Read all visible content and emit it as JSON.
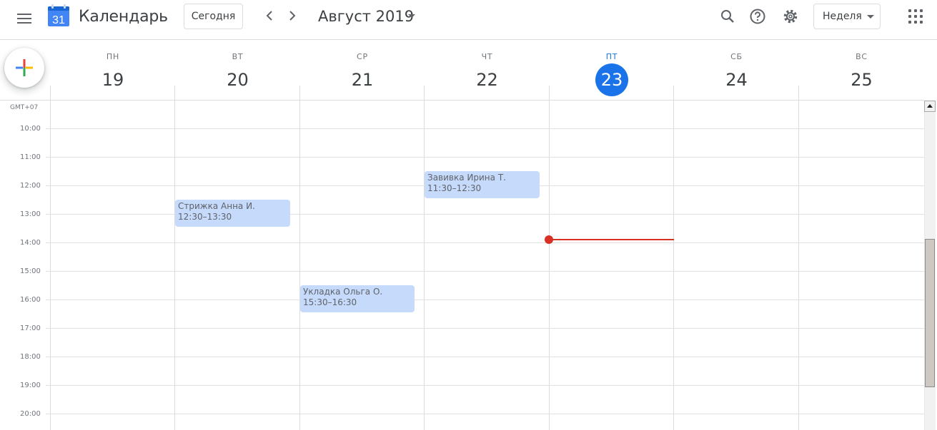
{
  "header": {
    "app_title": "Календарь",
    "logo_day": "31",
    "today_label": "Сегодня",
    "month_label": "Август 2019",
    "view_label": "Неделя",
    "icons": [
      "menu-icon",
      "prev-arrow-icon",
      "next-arrow-icon",
      "search-icon",
      "help-icon",
      "settings-icon",
      "apps-grid-icon"
    ]
  },
  "colors": {
    "accent": "#1a73e8",
    "event_bg": "#c6dafc",
    "now_line": "#d93025"
  },
  "timezone": "GMT+07",
  "days": [
    {
      "dow": "ПН",
      "num": "19",
      "today": false
    },
    {
      "dow": "ВТ",
      "num": "20",
      "today": false
    },
    {
      "dow": "СР",
      "num": "21",
      "today": false
    },
    {
      "dow": "ЧТ",
      "num": "22",
      "today": false
    },
    {
      "dow": "ПТ",
      "num": "23",
      "today": true
    },
    {
      "dow": "СБ",
      "num": "24",
      "today": false
    },
    {
      "dow": "ВС",
      "num": "25",
      "today": false
    }
  ],
  "hours": [
    "10:00",
    "11:00",
    "12:00",
    "13:00",
    "14:00",
    "15:00",
    "16:00",
    "17:00",
    "18:00",
    "19:00",
    "20:00"
  ],
  "events": [
    {
      "title": "Стрижка Анна И.",
      "time": "12:30–13:30",
      "day": "20"
    },
    {
      "title": "Укладка Ольга О.",
      "time": "15:30–16:30",
      "day": "21"
    },
    {
      "title": "Завивка Ирина Т.",
      "time": "11:30–12:30",
      "day": "22"
    }
  ]
}
